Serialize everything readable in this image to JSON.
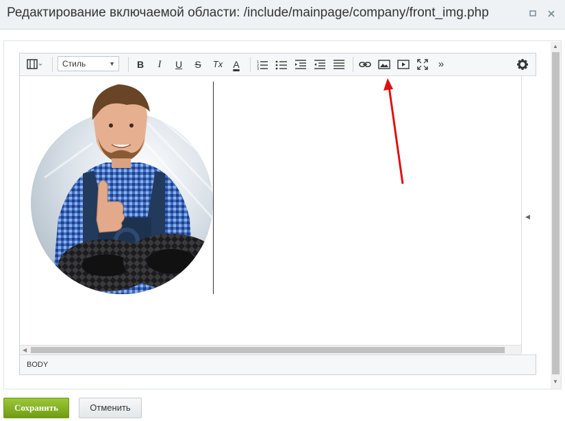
{
  "window": {
    "title": "Редактирование включаемой области: /include/mainpage/company/front_img.php",
    "maximize_icon": "maximize-icon",
    "close_icon": "close-icon"
  },
  "toolbar": {
    "style_label": "Стиль",
    "items": [
      "view-mode-icon",
      "bold-icon",
      "italic-icon",
      "underline-icon",
      "strikethrough-icon",
      "remove-format-icon",
      "font-color-icon",
      "ordered-list-icon",
      "unordered-list-icon",
      "outdent-icon",
      "indent-icon",
      "justify-icon",
      "link-icon",
      "image-icon",
      "video-icon",
      "fullscreen-icon",
      "more-icon",
      "settings-icon"
    ],
    "bold": "B",
    "italic": "I",
    "underline": "U",
    "strike": "S",
    "remove_format": "Tx",
    "font_color": "A",
    "more": "»"
  },
  "status": {
    "path": "BODY"
  },
  "buttons": {
    "save": "Сохранить",
    "cancel": "Отменить"
  },
  "colors": {
    "save_green": "#7aaa1c",
    "annotation_red": "#e01010"
  }
}
